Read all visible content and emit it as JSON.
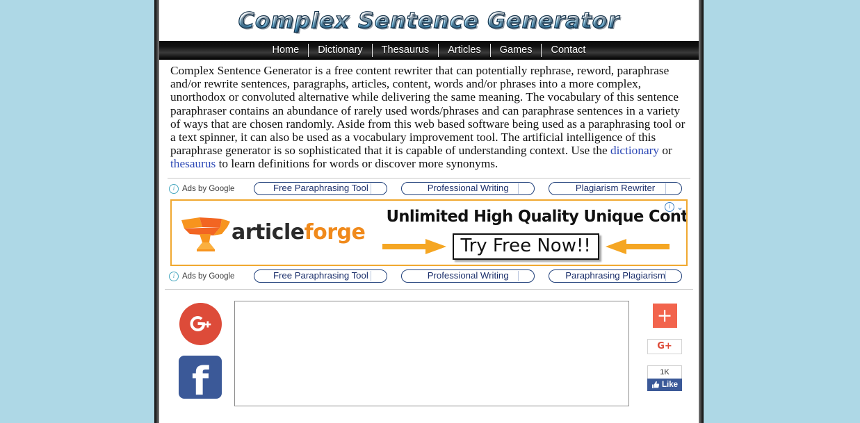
{
  "site": {
    "logo_text": "Complex Sentence Generator"
  },
  "nav": {
    "items": [
      {
        "label": "Home"
      },
      {
        "label": "Dictionary"
      },
      {
        "label": "Thesaurus"
      },
      {
        "label": "Articles"
      },
      {
        "label": "Games"
      },
      {
        "label": "Contact"
      }
    ]
  },
  "intro": {
    "part1": "Complex Sentence Generator is a free content rewriter that can potentially rephrase, reword, paraphrase and/or rewrite sentences, paragraphs, articles, content, words and/or phrases into a more complex, unorthodox or convoluted alternative while delivering the same meaning. The vocabulary of this sentence paraphraser contains an abundance of rarely used words/phrases and can paraphrase sentences in a variety of ways that are chosen randomly. Aside from this web based software being used as a paraphrasing tool or a text spinner, it can also be used as a vocabulary improvement tool. The artificial intelligence of this paraphrase generator is so sophisticated that it is capable of understanding context. Use the ",
    "link_dictionary": "dictionary",
    "middle": " or ",
    "link_thesaurus": "thesaurus",
    "part2": " to learn definitions for words or discover more synonyms."
  },
  "ads_top": {
    "label": "Ads by Google",
    "info_icon": "info-icon",
    "pills": [
      {
        "label": "Free Paraphrasing Tool"
      },
      {
        "label": "Professional Writing"
      },
      {
        "label": "Plagiarism Rewriter"
      }
    ]
  },
  "banner": {
    "logo_icon": "anvil-icon",
    "brand_first": "article",
    "brand_second": "forge",
    "headline": "Unlimited High Quality Unique Content",
    "cta": "Try Free Now!!",
    "info_icon": "info-icon",
    "chevron": "⌄",
    "border_color": "#f0a830",
    "accent_color": "#f08a1c"
  },
  "ads_bottom": {
    "label": "Ads by Google",
    "info_icon": "info-icon",
    "pills": [
      {
        "label": "Free Paraphrasing Tool"
      },
      {
        "label": "Professional Writing"
      },
      {
        "label": "Paraphrasing Plagiarism"
      }
    ]
  },
  "social_left": {
    "gplus_label": "G+",
    "facebook_label": "f"
  },
  "editor": {
    "value": "",
    "placeholder": ""
  },
  "share_right": {
    "addthis_label": "+",
    "gplus_label": "G+",
    "like_count": "1K",
    "like_label": "Like",
    "thumb_icon": "thumbs-up-icon"
  },
  "colors": {
    "page_background": "#aed8e6",
    "facebook_blue": "#3b5998",
    "gplus_red": "#dd4b39",
    "addthis_red": "#f2644d",
    "link_blue": "#2b47b5"
  }
}
